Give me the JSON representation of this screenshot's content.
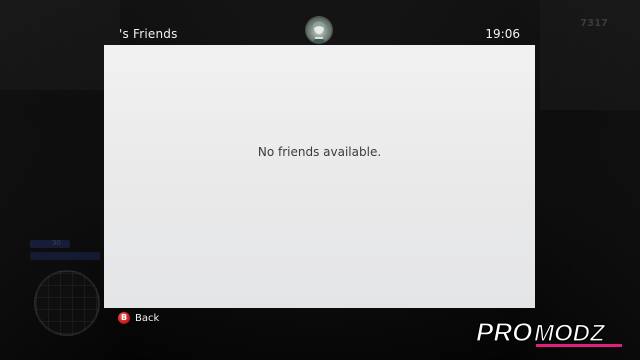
{
  "header": {
    "title": "'s Friends",
    "time": "19:06"
  },
  "panel": {
    "message": "No friends available."
  },
  "footer": {
    "back_button_glyph": "B",
    "back_label": "Back"
  },
  "background_hud": {
    "stat_text": "7317",
    "small_number": "30"
  },
  "watermark": {
    "text_pro": "PRO",
    "text_modz": "MODZ"
  },
  "colors": {
    "panel_bg": "#eaeaeb",
    "message_text": "#3c3c3c",
    "back_button": "#d32020",
    "watermark_pro": "#ffffff",
    "watermark_modz": "#e0207a"
  },
  "icons": {
    "gamerpic": "gamerpic-avatar-icon",
    "back_button": "b-button-icon"
  }
}
